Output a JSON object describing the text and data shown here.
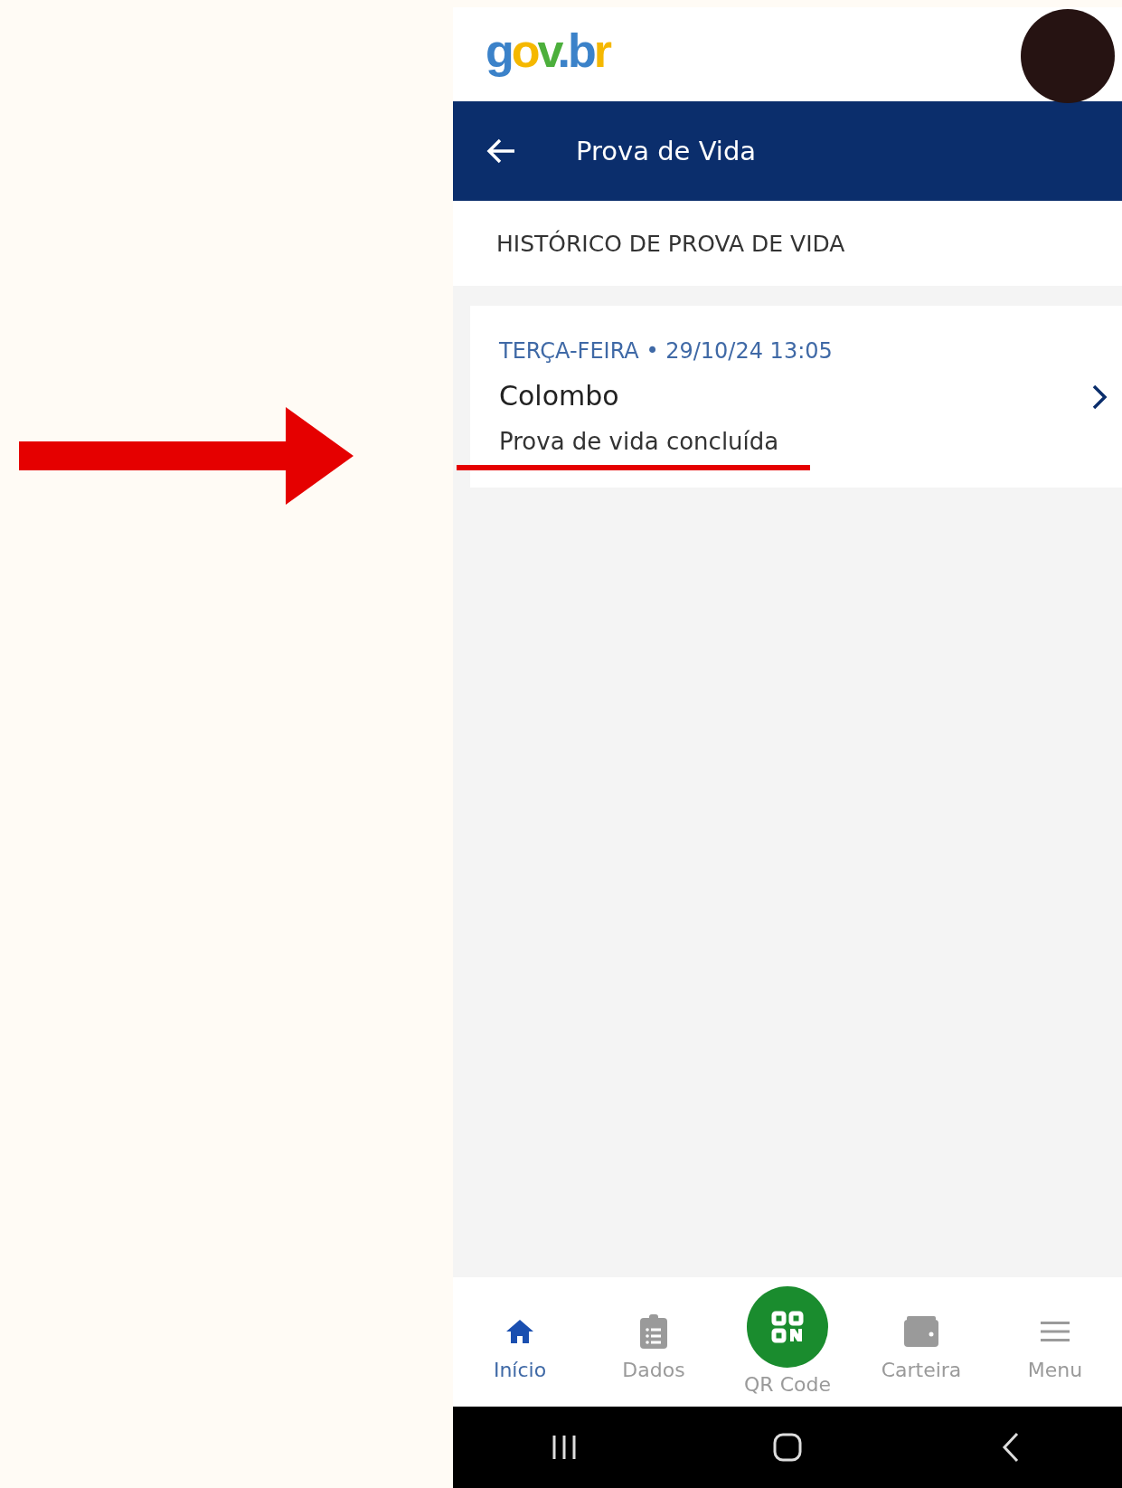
{
  "logo": [
    {
      "text": "g",
      "color": "#3b82c9"
    },
    {
      "text": "o",
      "color": "#f5b800"
    },
    {
      "text": "v",
      "color": "#4caf3c"
    },
    {
      "text": ".",
      "color": "#3b82c9"
    },
    {
      "text": "b",
      "color": "#3b82c9"
    },
    {
      "text": "r",
      "color": "#f5b800"
    }
  ],
  "app_bar": {
    "title": "Prova de Vida"
  },
  "section": {
    "title": "HISTÓRICO DE PROVA DE VIDA"
  },
  "entries": [
    {
      "date": "TERÇA-FEIRA • 29/10/24 13:05",
      "place": "Colombo",
      "status": "Prova de vida concluída"
    }
  ],
  "bottom_nav": [
    {
      "label": "Início",
      "kind": "tab",
      "selected": true
    },
    {
      "label": "Dados",
      "kind": "tab",
      "selected": false
    },
    {
      "label": "QR Code",
      "kind": "fab",
      "selected": false
    },
    {
      "label": "Carteira",
      "kind": "tab",
      "selected": false
    },
    {
      "label": "Menu",
      "kind": "tab",
      "selected": false
    }
  ]
}
